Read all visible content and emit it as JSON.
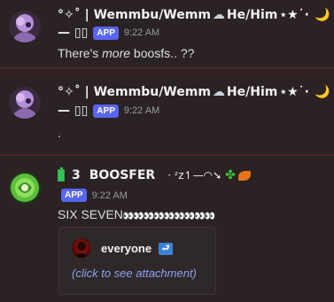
{
  "messages": [
    {
      "username": "°✧˚ | Wemmbu/Wemm",
      "tag_suffix": "He/Him",
      "decor": "⋆★˙·",
      "moon": "🌙",
      "subtitle": "— ▯▯",
      "badge": "APP",
      "timestamp": "9:22 AM",
      "text_before": "There's ",
      "text_emph": "more",
      "text_after": " boosfs.. ??"
    },
    {
      "username": "°✧˚ | Wemmbu/Wemm",
      "tag_suffix": "He/Him",
      "decor": "⋆★˙·",
      "moon": "🌙",
      "subtitle": "— ▯▯",
      "badge": "APP",
      "timestamp": "9:22 AM",
      "text": "."
    },
    {
      "username_prefix": "3",
      "username": "BOOSFER",
      "decor": "· ᶻz↿—◠➘",
      "badge": "APP",
      "timestamp": "9:22 AM",
      "text": "SIX SEVEN",
      "eyes": "👀👀👀👀👀👀👀👀👀",
      "embed": {
        "author": "everyone",
        "reply_icon": "⮐",
        "description": "(click to see attachment)"
      }
    }
  ],
  "colors": {
    "background": "#2b2223",
    "accent": "#5865f2",
    "link": "#8ea3f5"
  }
}
